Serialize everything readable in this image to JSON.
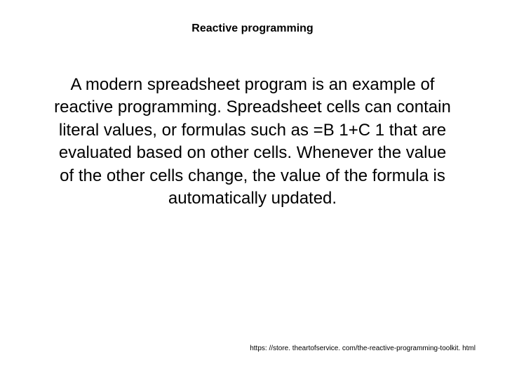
{
  "slide": {
    "title": "Reactive programming",
    "body": "A modern spreadsheet program is an example of reactive programming. Spreadsheet cells can contain literal values, or formulas such as =B 1+C 1 that are evaluated based on other cells. Whenever the value of the other cells change, the value of the formula is automatically updated.",
    "footer": "https: //store. theartofservice. com/the-reactive-programming-toolkit. html"
  }
}
